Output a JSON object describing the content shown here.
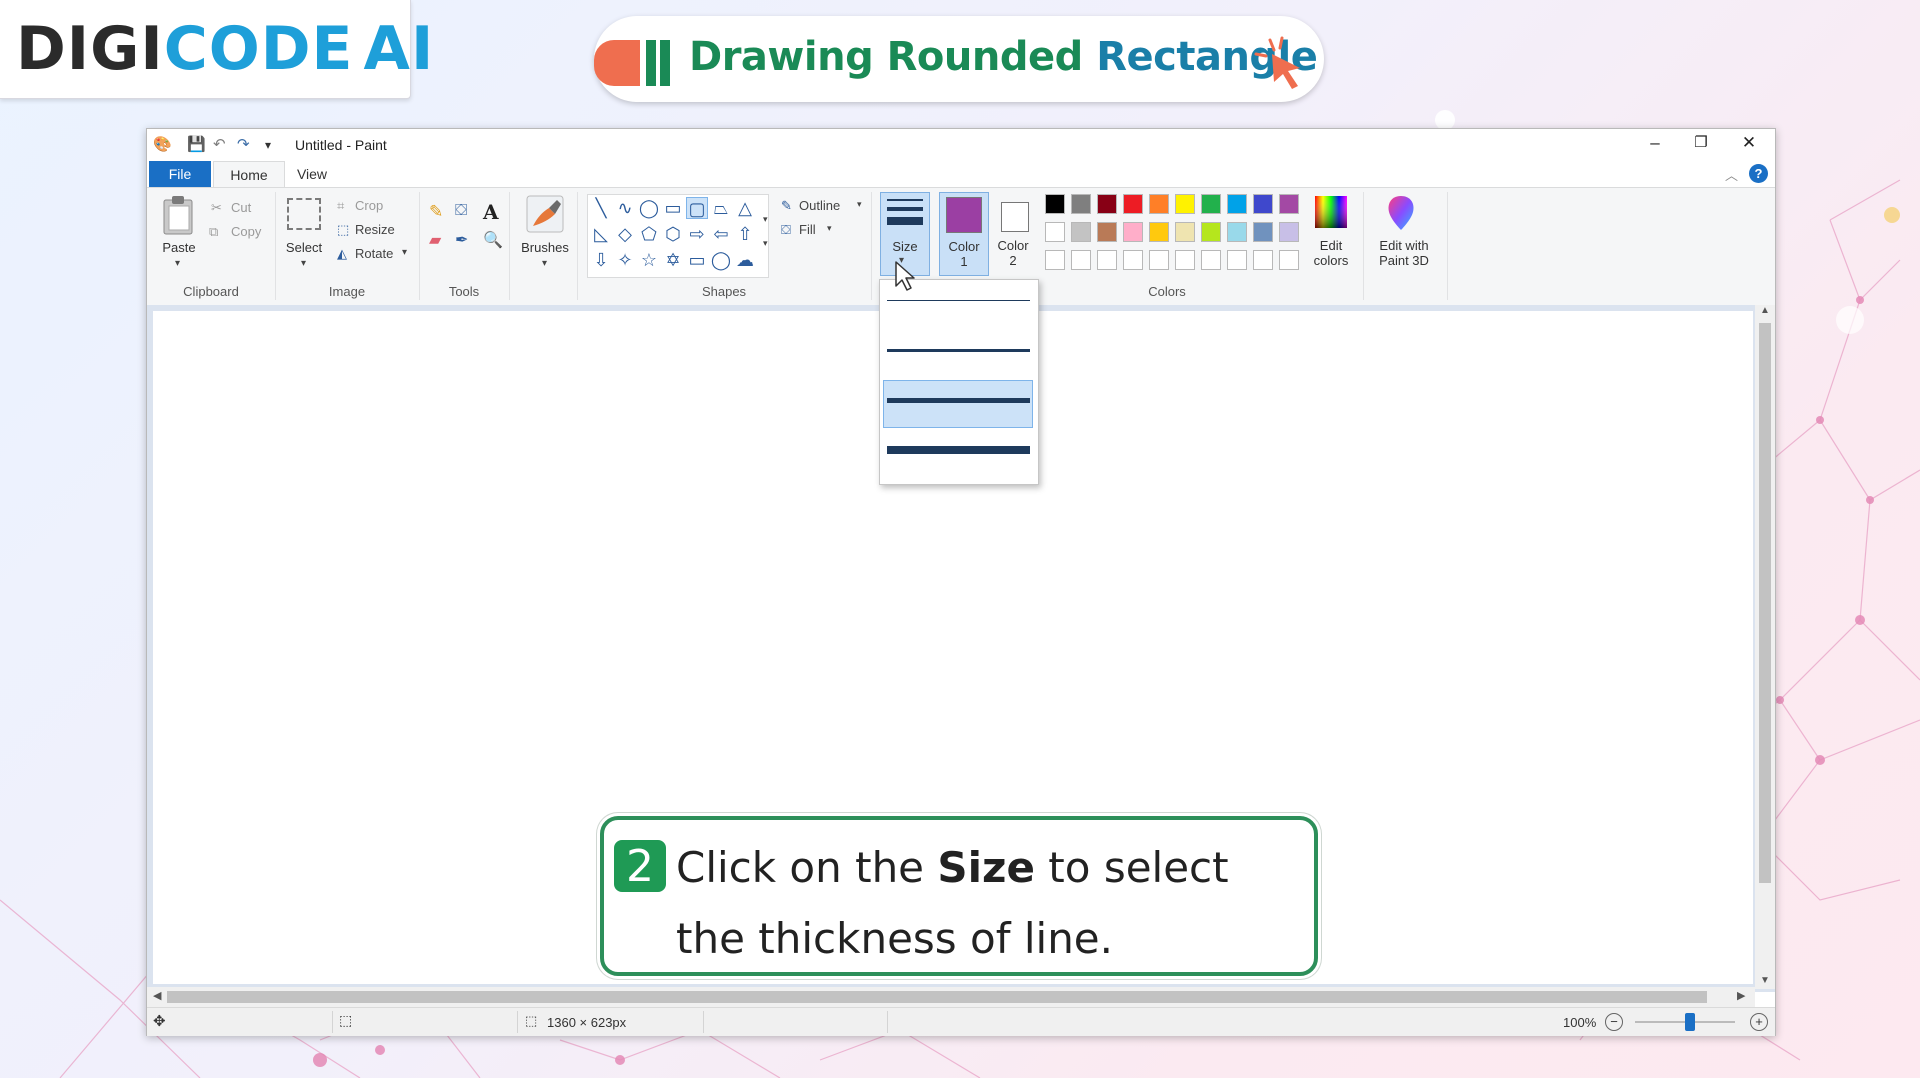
{
  "logo": {
    "part1": "DIGI",
    "part2": "CODE",
    "part3": "AI"
  },
  "header": {
    "title_green": "Drawing Rounded ",
    "title_blue": "Rectangle"
  },
  "window": {
    "title": "Untitled - Paint",
    "minimize": "–",
    "maximize": "❐",
    "close": "✕"
  },
  "tabs": {
    "file": "File",
    "home": "Home",
    "view": "View"
  },
  "ribbon": {
    "clipboard": {
      "label": "Clipboard",
      "paste": "Paste",
      "cut": "Cut",
      "copy": "Copy"
    },
    "image": {
      "label": "Image",
      "select": "Select",
      "crop": "Crop",
      "resize": "Resize",
      "rotate": "Rotate"
    },
    "tools": {
      "label": "Tools"
    },
    "brushes": {
      "label": "Brushes"
    },
    "shapes": {
      "label": "Shapes",
      "outline": "Outline",
      "fill": "Fill"
    },
    "size": {
      "label": "Size"
    },
    "color1": {
      "line1": "Color",
      "line2": "1",
      "value": "#9b3fa3"
    },
    "color2": {
      "line1": "Color",
      "line2": "2",
      "value": "#ffffff"
    },
    "colors": {
      "label": "Colors",
      "edit_line1": "Edit",
      "edit_line2": "colors"
    },
    "paint3d": {
      "line1": "Edit with",
      "line2": "Paint 3D"
    },
    "palette_row1": [
      "#000000",
      "#7f7f7f",
      "#880015",
      "#ed1c24",
      "#ff7f27",
      "#fff200",
      "#22b14c",
      "#00a2e8",
      "#3f48cc",
      "#a349a4"
    ],
    "palette_row2": [
      "#ffffff",
      "#c3c3c3",
      "#b97a57",
      "#ffaec9",
      "#ffc90e",
      "#efe4b0",
      "#b5e61d",
      "#99d9ea",
      "#7092be",
      "#c8bfe7"
    ]
  },
  "size_dropdown": {
    "options": [
      1,
      3,
      5,
      8
    ],
    "selected": 5
  },
  "status": {
    "dimensions": "1360 × 623px",
    "zoom": "100%",
    "zoom_fraction": 0.55
  },
  "instruction": {
    "step": "2",
    "pre": "Click on the ",
    "bold": "Size",
    "post": " to select the thickness of line."
  }
}
